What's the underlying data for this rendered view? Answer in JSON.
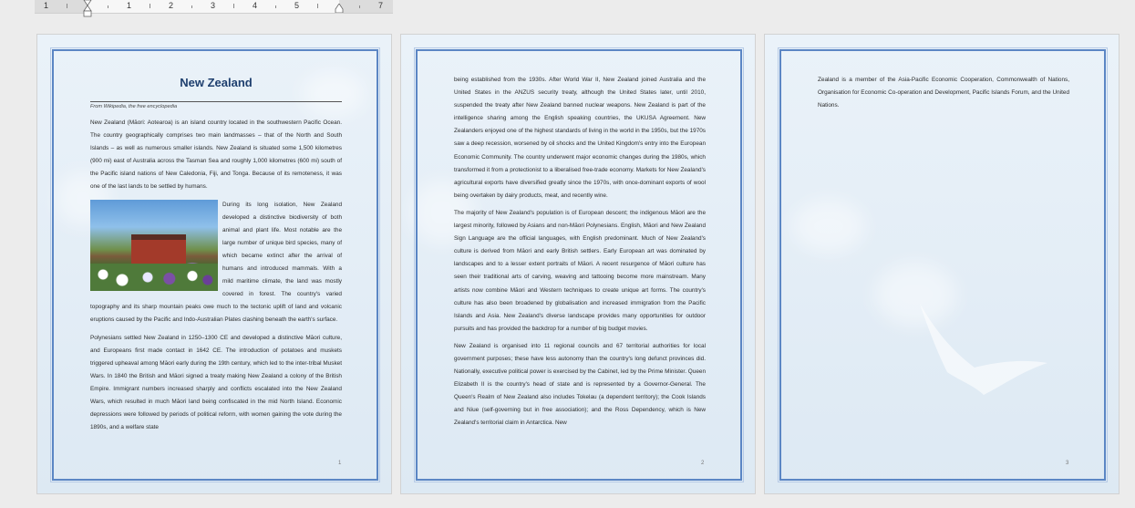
{
  "ruler": {
    "numbers": [
      "1",
      "1",
      "2",
      "3",
      "4",
      "5",
      "7"
    ]
  },
  "page1": {
    "title": "New Zealand",
    "source": "From Wikipedia, the free encyclopedia",
    "p1": "New Zealand (Māori: Aotearoa) is an island country located in the southwestern Pacific Ocean. The country geographically comprises two main landmasses – that of the North and South Islands – as well as numerous smaller islands. New Zealand is situated some 1,500 kilometres (900 mi) east of Australia across the Tasman Sea and roughly 1,000 kilometres (600 mi) south of the Pacific island nations of New Caledonia, Fiji, and Tonga. Because of its remoteness, it was one of the last lands to be settled by humans.",
    "p2": "During its long isolation, New Zealand developed a distinctive biodiversity of both animal and plant life. Most notable are the large number of unique bird species, many of which became extinct after the arrival of humans and introduced mammals. With a mild maritime climate, the land was mostly covered in forest. The country's varied topography and its sharp mountain peaks owe much to the tectonic uplift of land and volcanic eruptions caused by the Pacific and Indo-Australian Plates clashing beneath the earth's surface.",
    "p3": "Polynesians settled New Zealand in 1250–1300 CE and developed a distinctive Māori culture, and Europeans first made contact in 1642 CE. The introduction of potatoes and muskets triggered upheaval among Māori early during the 19th century, which led to the inter-tribal Musket Wars. In 1840 the British and Māori signed a treaty making New Zealand a colony of the British Empire. Immigrant numbers increased sharply and conflicts escalated into the New Zealand Wars, which resulted in much Māori land being confiscated in the mid North Island. Economic depressions were followed by periods of political reform, with women gaining the vote during the 1890s, and a welfare state",
    "page_number": "1"
  },
  "page2": {
    "p1": "being established from the 1930s. After World War II, New Zealand joined Australia and the United States in the ANZUS security treaty, although the United States later, until 2010, suspended the treaty after New Zealand banned nuclear weapons. New Zealand is part of the intelligence sharing among the English speaking countries, the UKUSA Agreement. New Zealanders enjoyed one of the highest standards of living in the world in the 1950s, but the 1970s saw a deep recession, worsened by oil shocks and the United Kingdom's entry into the European Economic Community. The country underwent major economic changes during the 1980s, which transformed it from a protectionist to a liberalised free-trade economy. Markets for New Zealand's agricultural exports have diversified greatly since the 1970s, with once-dominant exports of wool being overtaken by dairy products, meat, and recently wine.",
    "p2": "The majority of New Zealand's population is of European descent; the indigenous Māori are the largest minority, followed by Asians and non-Māori Polynesians. English, Māori and New Zealand Sign Language are the official languages, with English predominant. Much of New Zealand's culture is derived from Māori and early British settlers. Early European art was dominated by landscapes and to a lesser extent portraits of Māori. A recent resurgence of Māori culture has seen their traditional arts of carving, weaving and tattooing become more mainstream. Many artists now combine Māori and Western techniques to create unique art forms. The country's culture has also been broadened by globalisation and increased immigration from the Pacific Islands and Asia. New Zealand's diverse landscape provides many opportunities for outdoor pursuits and has provided the backdrop for a number of big budget movies.",
    "p3": "New Zealand is organised into 11 regional councils and 67 territorial authorities for local government purposes; these have less autonomy than the country's long defunct provinces did. Nationally, executive political power is exercised by the Cabinet, led by the Prime Minister. Queen Elizabeth II is the country's head of state and is represented by a Governor-General. The Queen's Realm of New Zealand also includes Tokelau (a dependent territory); the Cook Islands and Niue (self-governing but in free association); and the Ross Dependency, which is New Zealand's territorial claim in Antarctica. New",
    "page_number": "2"
  },
  "page3": {
    "p1": "Zealand is a member of the Asia-Pacific Economic Cooperation, Commonwealth of Nations, Organisation for Economic Co-operation and Development, Pacific Islands Forum, and the United Nations.",
    "page_number": "3"
  }
}
